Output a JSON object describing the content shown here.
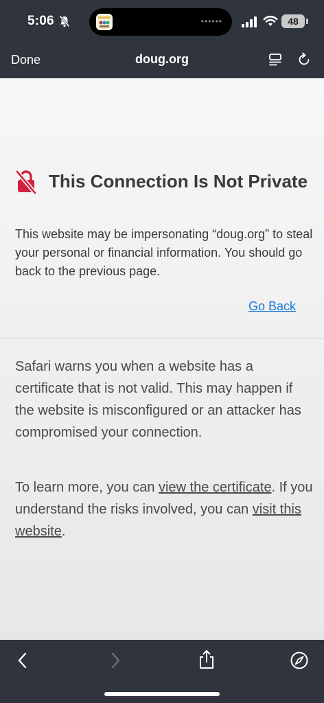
{
  "status_bar": {
    "time": "5:06",
    "battery": "48"
  },
  "nav": {
    "done_label": "Done",
    "url": "doug.org"
  },
  "warning": {
    "title": "This Connection Is Not Private",
    "body": "This website may be impersonating “doug.org” to steal your personal or financial information. You should go back to the previous page.",
    "go_back": "Go Back"
  },
  "details": {
    "explanation": "Safari warns you when a website has a certificate that is not valid. This may happen if the website is misconfigured or an attacker has compromised your connection.",
    "learn_prefix": "To learn more, you can ",
    "view_cert": "view the certificate",
    "learn_middle": ". If you understand the risks involved, you can ",
    "visit_site": "visit this website",
    "learn_suffix": "."
  },
  "icons": {
    "silent": "bell-slash-icon",
    "signal": "cellular-signal-icon",
    "wifi": "wifi-icon",
    "reader": "reader-mode-icon",
    "reload": "reload-icon",
    "lock": "broken-lock-icon",
    "back": "chevron-left-icon",
    "forward": "chevron-right-icon",
    "share": "share-icon",
    "safari": "compass-icon"
  },
  "colors": {
    "bar": "#2f343d",
    "link": "#1a7bd8",
    "warning_icon": "#d0223f"
  }
}
